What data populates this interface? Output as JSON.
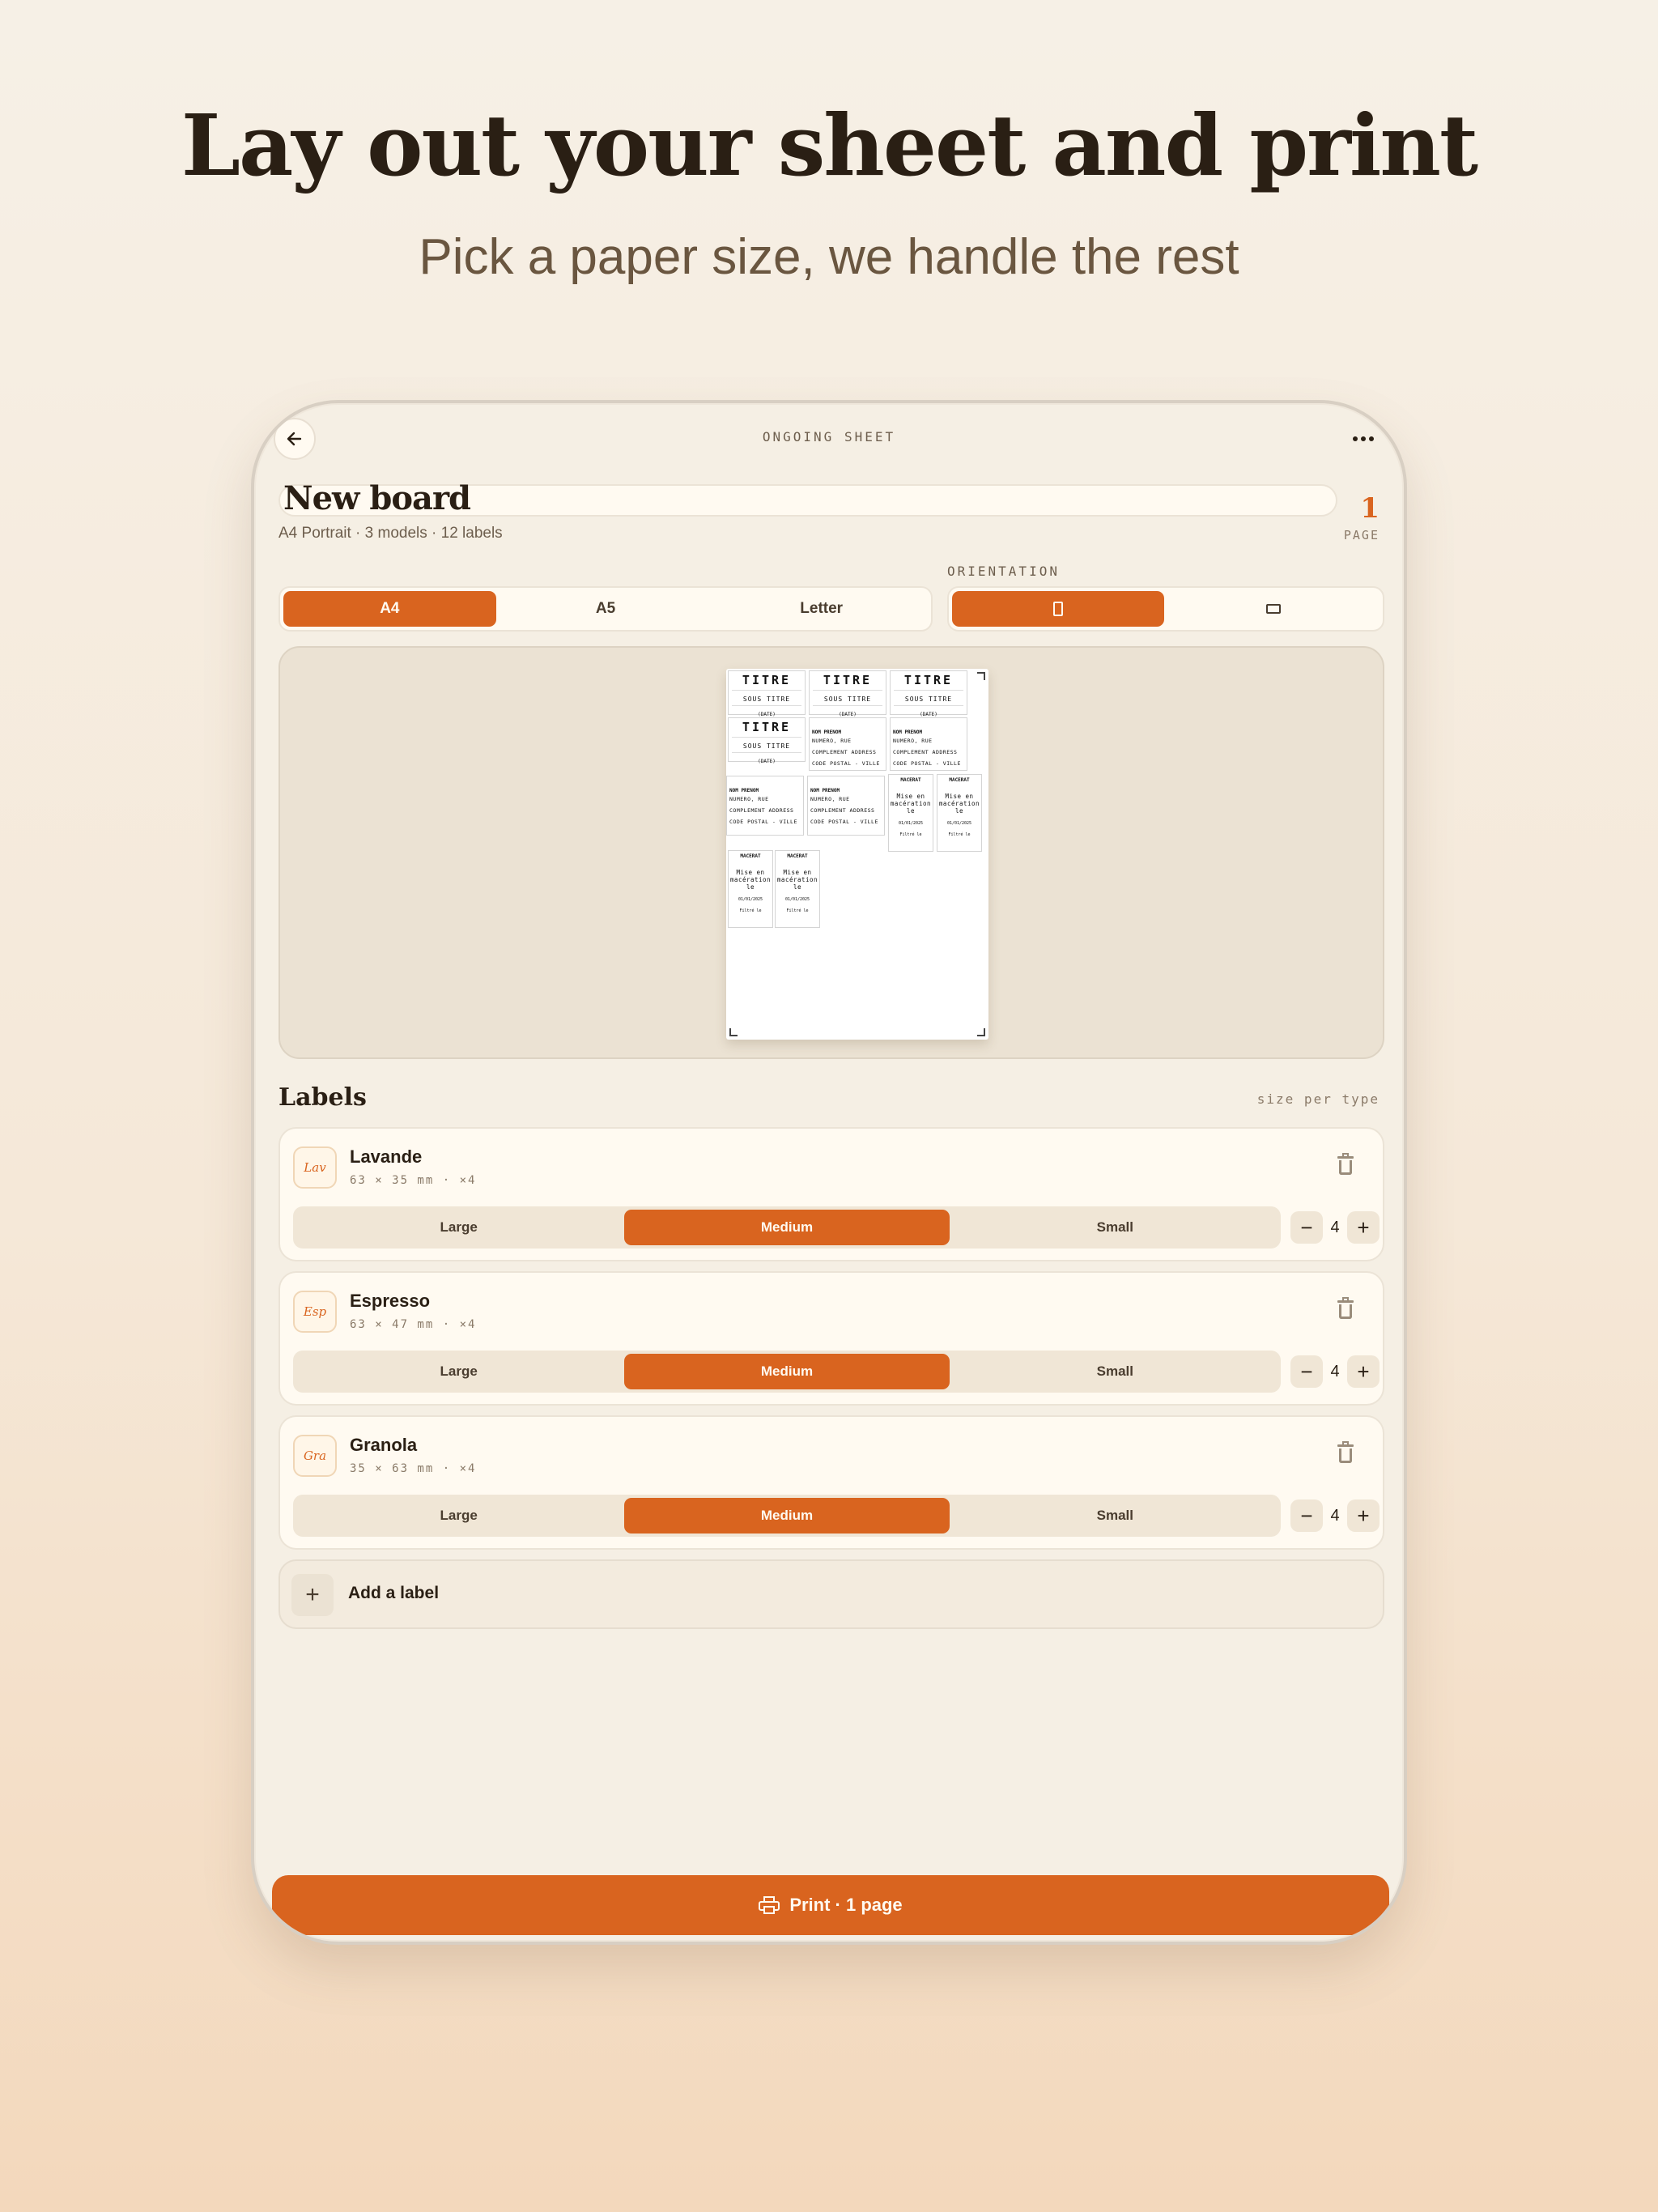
{
  "hero": {
    "headline": "Lay out your sheet and print",
    "subhead": "Pick a paper size, we handle the rest"
  },
  "topbar": {
    "title": "ONGOING SHEET",
    "back_icon": "arrow-left-icon",
    "more_icon": "more-horizontal-icon"
  },
  "board": {
    "title": "New board",
    "meta": "A4 Portrait · 3 models · 12 labels",
    "page_count": "1",
    "page_label": "PAGE"
  },
  "paper_sizes": {
    "options": [
      "A4",
      "A5",
      "Letter"
    ],
    "selected": "A4"
  },
  "orientation": {
    "label": "ORIENTATION",
    "options": [
      "portrait",
      "landscape"
    ],
    "selected": "portrait"
  },
  "preview": {
    "title_labels": [
      {
        "title": "TITRE",
        "subtitle": "SOUS TITRE",
        "date": "(DATE)"
      },
      {
        "title": "TITRE",
        "subtitle": "SOUS TITRE",
        "date": "(DATE)"
      },
      {
        "title": "TITRE",
        "subtitle": "SOUS TITRE",
        "date": "(DATE)"
      },
      {
        "title": "TITRE",
        "subtitle": "SOUS TITRE",
        "date": "(DATE)"
      }
    ],
    "address_labels": [
      {
        "name": "NOM PRENOM",
        "line1": "NUMERO, RUE",
        "line2": "COMPLEMENT ADDRESS",
        "line3": "CODE POSTAL - VILLE"
      },
      {
        "name": "NOM PRENOM",
        "line1": "NUMERO, RUE",
        "line2": "COMPLEMENT ADDRESS",
        "line3": "CODE POSTAL - VILLE"
      },
      {
        "name": "NOM PRENOM",
        "line1": "NUMERO, RUE",
        "line2": "COMPLEMENT ADDRESS",
        "line3": "CODE POSTAL - VILLE"
      },
      {
        "name": "NOM PRENOM",
        "line1": "NUMERO, RUE",
        "line2": "COMPLEMENT ADDRESS",
        "line3": "CODE POSTAL - VILLE"
      }
    ],
    "maceration_labels": [
      {
        "head": "MACERAT",
        "text": "Mise en macération le",
        "date": "01/01/2025",
        "filter": "Filtré le"
      },
      {
        "head": "MACERAT",
        "text": "Mise en macération le",
        "date": "01/01/2025",
        "filter": "Filtré le"
      },
      {
        "head": "MACERAT",
        "text": "Mise en macération le",
        "date": "01/01/2025",
        "filter": "Filtré le"
      },
      {
        "head": "MACERAT",
        "text": "Mise en macération le",
        "date": "01/01/2025",
        "filter": "Filtré le"
      }
    ]
  },
  "labels_section": {
    "title": "Labels",
    "hint": "size per type",
    "items": [
      {
        "badge": "Lav",
        "name": "Lavande",
        "dims": "63 × 35 mm · ×4",
        "sizes": [
          "Large",
          "Medium",
          "Small"
        ],
        "selected": "Medium",
        "qty": "4"
      },
      {
        "badge": "Esp",
        "name": "Espresso",
        "dims": "63 × 47 mm · ×4",
        "sizes": [
          "Large",
          "Medium",
          "Small"
        ],
        "selected": "Medium",
        "qty": "4"
      },
      {
        "badge": "Gra",
        "name": "Granola",
        "dims": "35 × 63 mm · ×4",
        "sizes": [
          "Large",
          "Medium",
          "Small"
        ],
        "selected": "Medium",
        "qty": "4"
      }
    ],
    "add_label": "Add a label",
    "minus": "−",
    "plus": "+"
  },
  "print_button": {
    "label": "Print · 1 page",
    "icon": "printer-icon"
  },
  "colors": {
    "accent": "#d9641f",
    "background": "#f5efe4",
    "text": "#2a1f14"
  }
}
